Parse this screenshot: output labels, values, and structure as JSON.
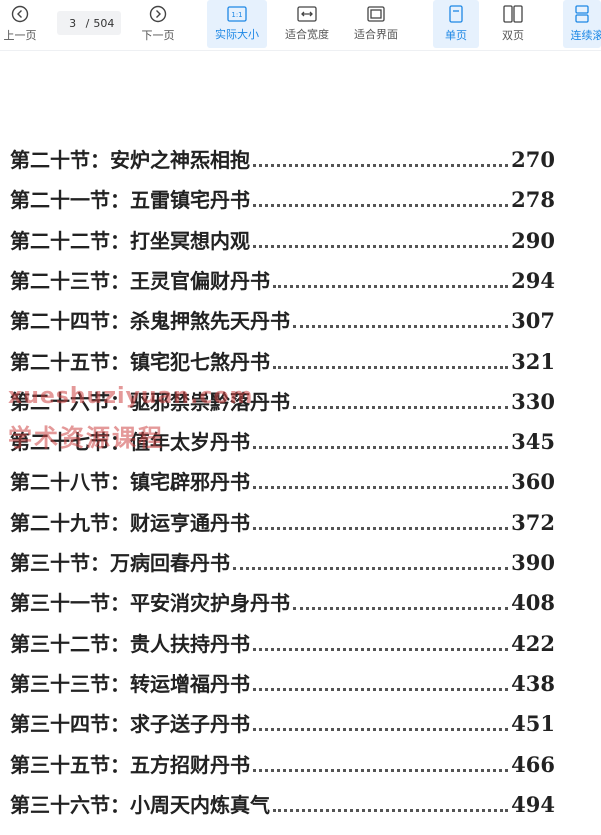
{
  "toolbar": {
    "prev_label": "上一页",
    "next_label": "下一页",
    "page_current": "3",
    "page_separator": "/",
    "page_total": "504",
    "actual_size_label": "实际大小",
    "actual_size_icon_text": "1:1",
    "fit_width_label": "适合宽度",
    "fit_page_label": "适合界面",
    "single_page_label": "单页",
    "double_page_label": "双页",
    "continuous_label": "连续滚"
  },
  "accent_color": "#1e88e5",
  "toc": [
    {
      "title": "第二十节：安炉之神炁相抱",
      "page": "270"
    },
    {
      "title": "第二十一节：五雷镇宅丹书",
      "page": "278"
    },
    {
      "title": "第二十二节：打坐冥想内观",
      "page": "290"
    },
    {
      "title": "第二十三节：王灵官偏财丹书",
      "page": "294"
    },
    {
      "title": "第二十四节：杀鬼押煞先天丹书",
      "page": "307"
    },
    {
      "title": "第二十五节：镇宅犯七煞丹书",
      "page": "321"
    },
    {
      "title": "第二十六节：驱邪禁祟黔落丹书",
      "page": "330"
    },
    {
      "title": "第二十七节：值年太岁丹书",
      "page": "345"
    },
    {
      "title": "第二十八节：镇宅辟邪丹书",
      "page": "360"
    },
    {
      "title": "第二十九节：财运亨通丹书",
      "page": "372"
    },
    {
      "title": "第三十节：万病回春丹书",
      "page": "390"
    },
    {
      "title": "第三十一节：平安消灾护身丹书",
      "page": "408"
    },
    {
      "title": "第三十二节：贵人扶持丹书",
      "page": "422"
    },
    {
      "title": "第三十三节：转运增福丹书",
      "page": "438"
    },
    {
      "title": "第三十四节：求子送子丹书",
      "page": "451"
    },
    {
      "title": "第三十五节：五方招财丹书",
      "page": "466"
    },
    {
      "title": "第三十六节：小周天内炼真气",
      "page": "494"
    }
  ],
  "watermark": {
    "line1": "xueshuziyuan.com",
    "line2": "学术资源课程"
  }
}
